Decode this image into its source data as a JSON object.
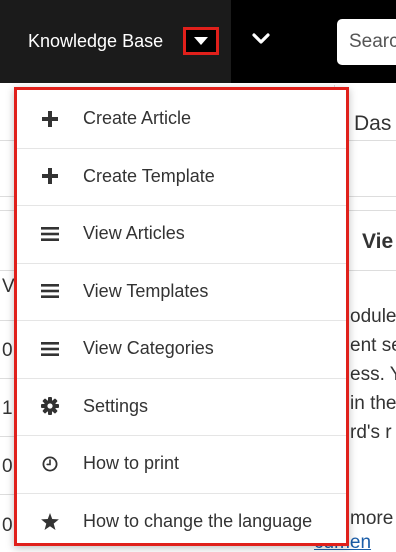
{
  "navbar": {
    "module_label": "Knowledge Base",
    "caret_icon": "caret-down-icon",
    "more_icon": "chevron-down-icon",
    "search_placeholder": "Searc"
  },
  "background": {
    "breadcrumb": "Das",
    "section_title": "Vie",
    "row_labels": [
      "V",
      "0",
      "1",
      "0",
      "0"
    ],
    "paragraph_lines": [
      "odule",
      "ent se",
      "ess. Y",
      "in the",
      "rd's r"
    ],
    "more_text": "more",
    "link_text": "cumen"
  },
  "menu": {
    "accent_color": "#e0201b",
    "items": [
      {
        "label": "Create Article",
        "icon": "plus-icon"
      },
      {
        "label": "Create Template",
        "icon": "plus-icon"
      },
      {
        "label": "View Articles",
        "icon": "list-icon"
      },
      {
        "label": "View Templates",
        "icon": "list-icon"
      },
      {
        "label": "View Categories",
        "icon": "list-icon"
      },
      {
        "label": "Settings",
        "icon": "gear-icon"
      },
      {
        "label": "How to print",
        "icon": "clock-icon"
      },
      {
        "label": "How to change the language",
        "icon": "star-icon"
      }
    ]
  }
}
